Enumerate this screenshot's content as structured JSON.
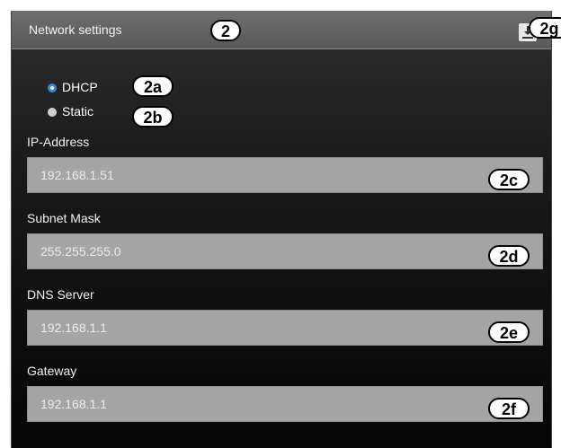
{
  "header": {
    "title": "Network settings"
  },
  "mode": {
    "options": [
      {
        "label": "DHCP",
        "selected": true
      },
      {
        "label": "Static",
        "selected": false
      }
    ]
  },
  "fields": {
    "ip": {
      "label": "IP-Address",
      "value": "192.168.1.51"
    },
    "subnet": {
      "label": "Subnet Mask",
      "value": "255.255.255.0"
    },
    "dns": {
      "label": "DNS Server",
      "value": "192.168.1.1"
    },
    "gateway": {
      "label": "Gateway",
      "value": "192.168.1.1"
    }
  },
  "callouts": {
    "panel": "2",
    "dhcp": "2a",
    "static": "2b",
    "ip": "2c",
    "subnet": "2d",
    "dns": "2e",
    "gateway": "2f",
    "save": "2g"
  },
  "colors": {
    "radio_checked": "#3a86d8",
    "field_bg": "#a4a4a4"
  },
  "icons": {
    "save": "download-icon"
  }
}
